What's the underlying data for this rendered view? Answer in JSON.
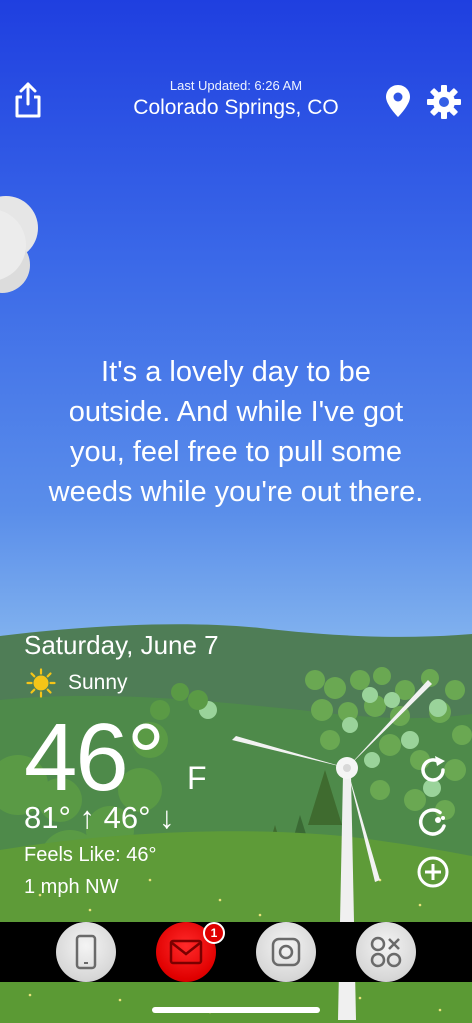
{
  "header": {
    "last_updated": "Last Updated: 6:26 AM",
    "location": "Colorado Springs, CO",
    "share_icon": "share-icon",
    "location_icon": "map-pin-icon",
    "settings_icon": "gear-icon"
  },
  "message": {
    "lines": [
      "It's a lovely day to be",
      "outside. And while I've got",
      "you, feel free to pull some",
      "weeds while you're out there."
    ]
  },
  "weather": {
    "date": "Saturday, June 7",
    "condition": "Sunny",
    "condition_icon": "sun-icon",
    "temperature": "46°",
    "unit": "F",
    "high": "81°",
    "low": "46°",
    "hilo_text": "81° ↑  46° ↓",
    "feels_like": "Feels Like: 46°",
    "wind": "1 mph NW"
  },
  "side_controls": [
    "refresh-icon",
    "time-travel-icon",
    "add-icon"
  ],
  "dock": {
    "apps": [
      "phone-app-icon",
      "mail-app-icon",
      "camera-app-icon",
      "apps-grid-icon"
    ],
    "mail_badge": "1"
  },
  "colors": {
    "sky_top": "#1f3fe0",
    "sky_bottom": "#8bb8ee",
    "hill_far": "#4f7d52",
    "grass": "#5f9a3c",
    "dock_bg": "#000000",
    "mail_red": "#e00000",
    "sun_yellow": "#f5c518"
  }
}
